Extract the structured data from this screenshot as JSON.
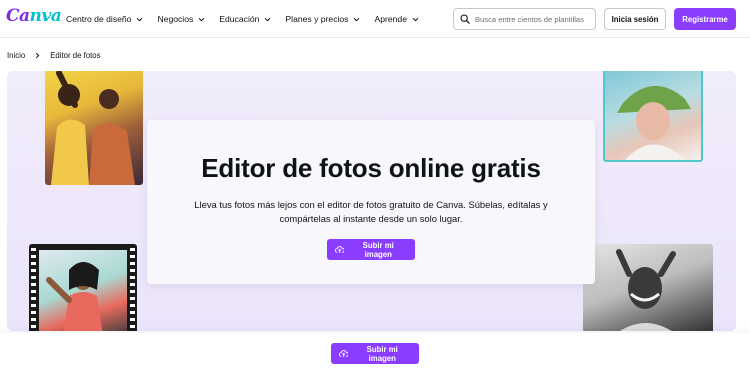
{
  "brand": {
    "logo_text_1": "Ca",
    "logo_text_2": "nva"
  },
  "nav": {
    "items": [
      {
        "label": "Centro de diseño"
      },
      {
        "label": "Negocios"
      },
      {
        "label": "Educación"
      },
      {
        "label": "Planes y precios"
      },
      {
        "label": "Aprende"
      }
    ]
  },
  "search": {
    "placeholder": "Busca entre cientos de plantillas"
  },
  "auth": {
    "login_label": "Inicia sesión",
    "signup_label": "Registrarme"
  },
  "breadcrumb": {
    "home": "Inicio",
    "current": "Editor de fotos"
  },
  "hero": {
    "title": "Editor de fotos online gratis",
    "description": "Lleva tus fotos más lejos con el editor de fotos gratuito de Canva. Súbelas, edítalas y compártelas al instante desde un solo lugar.",
    "cta_label": "Subir mi imagen"
  },
  "sticky_bar": {
    "cta_label": "Subir mi imagen"
  },
  "colors": {
    "accent": "#8b3dff",
    "hero_bg": "#ece6fa",
    "photo_frame": "#4fc9c9"
  }
}
